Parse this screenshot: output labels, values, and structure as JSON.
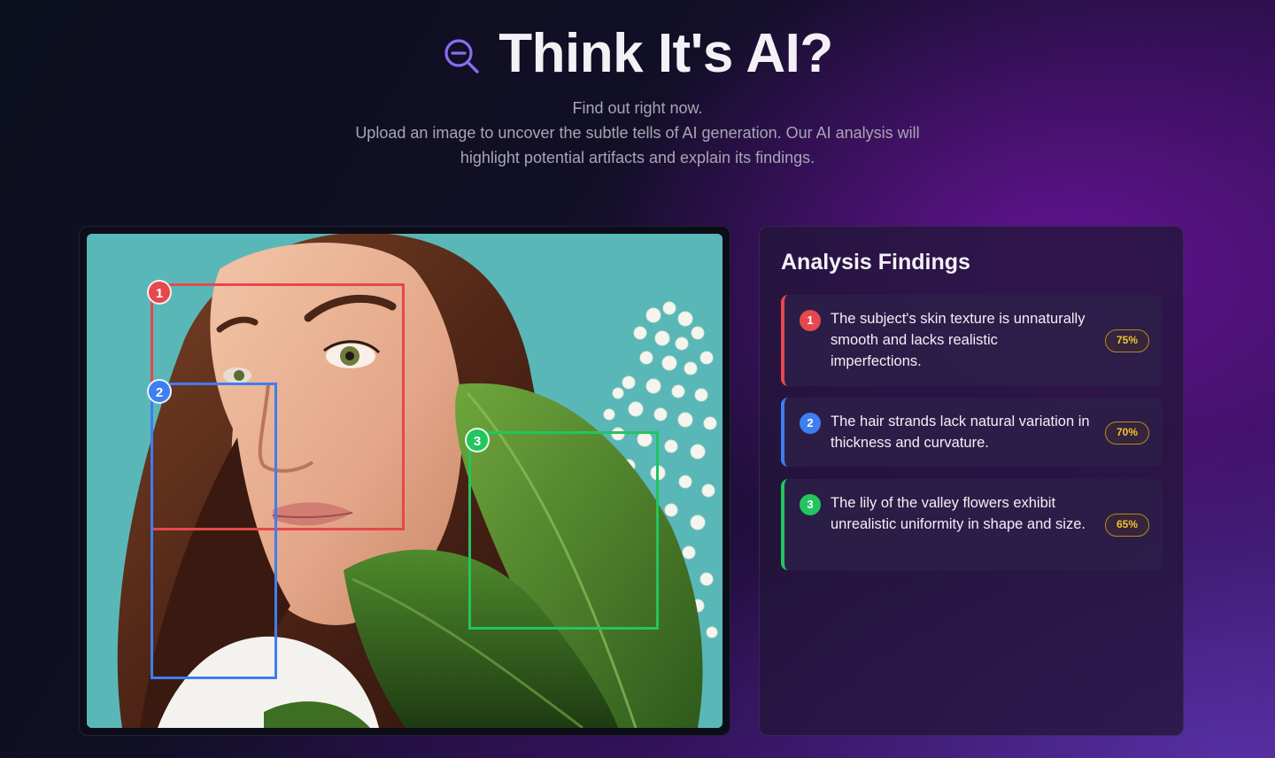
{
  "header": {
    "title": "Think It's AI?",
    "subtitle": "Find out right now.",
    "description": "Upload an image to uncover the subtle tells of AI generation. Our AI analysis will highlight potential artifacts and explain its findings."
  },
  "image_panel": {
    "markers": [
      "1",
      "2",
      "3"
    ]
  },
  "findings": {
    "title": "Analysis Findings",
    "items": [
      {
        "number": "1",
        "text": "The subject's skin texture is unnaturally smooth and lacks realistic imperfections.",
        "confidence": "75%",
        "color": "#e5484d"
      },
      {
        "number": "2",
        "text": "The hair strands lack natural variation in thickness and curvature.",
        "confidence": "70%",
        "color": "#3e7ef0"
      },
      {
        "number": "3",
        "text": "The lily of the valley flowers exhibit unrealistic uniformity in shape and size.",
        "confidence": "65%",
        "color": "#22c55e"
      }
    ]
  },
  "icons": {
    "title_icon": "search-zoom-out-icon"
  },
  "colors": {
    "accent": "#8b5cf6",
    "badge": "#f2c230"
  }
}
